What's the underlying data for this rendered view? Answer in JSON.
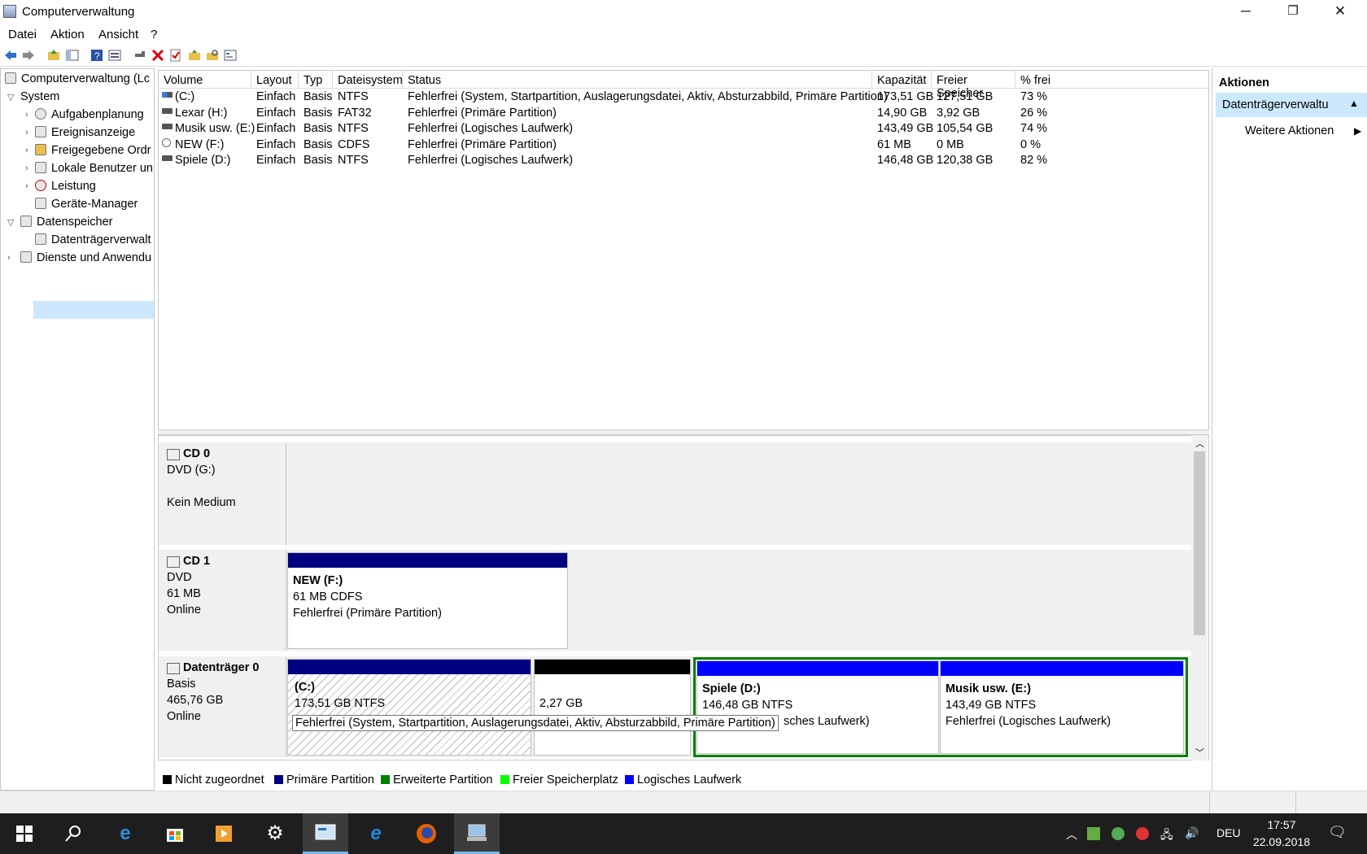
{
  "window": {
    "title": "Computerverwaltung",
    "minimize_glyph": "─",
    "maximize_glyph": "❐",
    "close_glyph": "✕"
  },
  "menu": [
    "Datei",
    "Aktion",
    "Ansicht",
    "?"
  ],
  "toolbar_icons": [
    "back-icon",
    "forward-icon",
    "up-folder-icon",
    "show-hide-tree-icon",
    "help-icon",
    "properties-icon",
    "connect-icon",
    "delete-icon",
    "check-icon",
    "open-icon",
    "explore-icon",
    "console-icon"
  ],
  "tree": {
    "root": "Computerverwaltung (Lc",
    "system": "System",
    "items": [
      "Aufgabenplanung",
      "Ereignisanzeige",
      "Freigegebene Ordr",
      "Lokale Benutzer un",
      "Leistung",
      "Geräte-Manager"
    ],
    "storage": "Datenspeicher",
    "diskmgmt": "Datenträgerverwalt",
    "services": "Dienste und Anwendu",
    "scroll_left": "<",
    "scroll_right": ">"
  },
  "table": {
    "headers": [
      "Volume",
      "Layout",
      "Typ",
      "Dateisystem",
      "Status",
      "Kapazität",
      "Freier Speicher",
      "% frei"
    ],
    "rows": [
      [
        "(C:)",
        "Einfach",
        "Basis",
        "NTFS",
        "Fehlerfrei (System, Startpartition, Auslagerungsdatei, Aktiv, Absturzabbild, Primäre Partition)",
        "173,51 GB",
        "127,51 GB",
        "73 %"
      ],
      [
        "Lexar (H:)",
        "Einfach",
        "Basis",
        "FAT32",
        "Fehlerfrei (Primäre Partition)",
        "14,90 GB",
        "3,92 GB",
        "26 %"
      ],
      [
        "Musik usw. (E:)",
        "Einfach",
        "Basis",
        "NTFS",
        "Fehlerfrei (Logisches Laufwerk)",
        "143,49 GB",
        "105,54 GB",
        "74 %"
      ],
      [
        "NEW (F:)",
        "Einfach",
        "Basis",
        "CDFS",
        "Fehlerfrei (Primäre Partition)",
        "61 MB",
        "0 MB",
        "0 %"
      ],
      [
        "Spiele (D:)",
        "Einfach",
        "Basis",
        "NTFS",
        "Fehlerfrei (Logisches Laufwerk)",
        "146,48 GB",
        "120,38 GB",
        "82 %"
      ]
    ]
  },
  "disks": {
    "cd0": {
      "name": "CD 0",
      "type": "DVD (G:)",
      "media": "Kein Medium"
    },
    "cd1": {
      "name": "CD 1",
      "type": "DVD",
      "size": "61 MB",
      "state": "Online",
      "part": {
        "name": "NEW  (F:)",
        "size": "61 MB CDFS",
        "status": "Fehlerfrei (Primäre Partition)"
      }
    },
    "disk0": {
      "name": "Datenträger 0",
      "type": "Basis",
      "size": "465,76 GB",
      "state": "Online",
      "c": {
        "name": "(C:)",
        "size": "173,51 GB NTFS"
      },
      "unalloc": {
        "size": "2,27 GB"
      },
      "d": {
        "name": "Spiele  (D:)",
        "size": "146,48 GB NTFS",
        "status_tail": "sches Laufwerk)"
      },
      "e": {
        "name": "Musik usw.  (E:)",
        "size": "143,49 GB NTFS",
        "status": "Fehlerfrei (Logisches Laufwerk)"
      }
    },
    "tooltip": "Fehlerfrei (System, Startpartition, Auslagerungsdatei, Aktiv, Absturzabbild, Primäre Partition)"
  },
  "legend": [
    {
      "label": "Nicht zugeordnet",
      "color": "#000000"
    },
    {
      "label": "Primäre Partition",
      "color": "#000080"
    },
    {
      "label": "Erweiterte Partition",
      "color": "#008000"
    },
    {
      "label": "Freier Speicherplatz",
      "color": "#00ff00"
    },
    {
      "label": "Logisches Laufwerk",
      "color": "#0000ff"
    }
  ],
  "actions": {
    "header": "Aktionen",
    "section": "Datenträgerverwaltu",
    "more": "Weitere Aktionen"
  },
  "taskbar": {
    "lang": "DEU",
    "time": "17:57",
    "date": "22.09.2018"
  },
  "colors": {
    "primary": "#000080",
    "logical": "#0000ff",
    "extended": "#008000",
    "selection": "#cce8ff"
  }
}
